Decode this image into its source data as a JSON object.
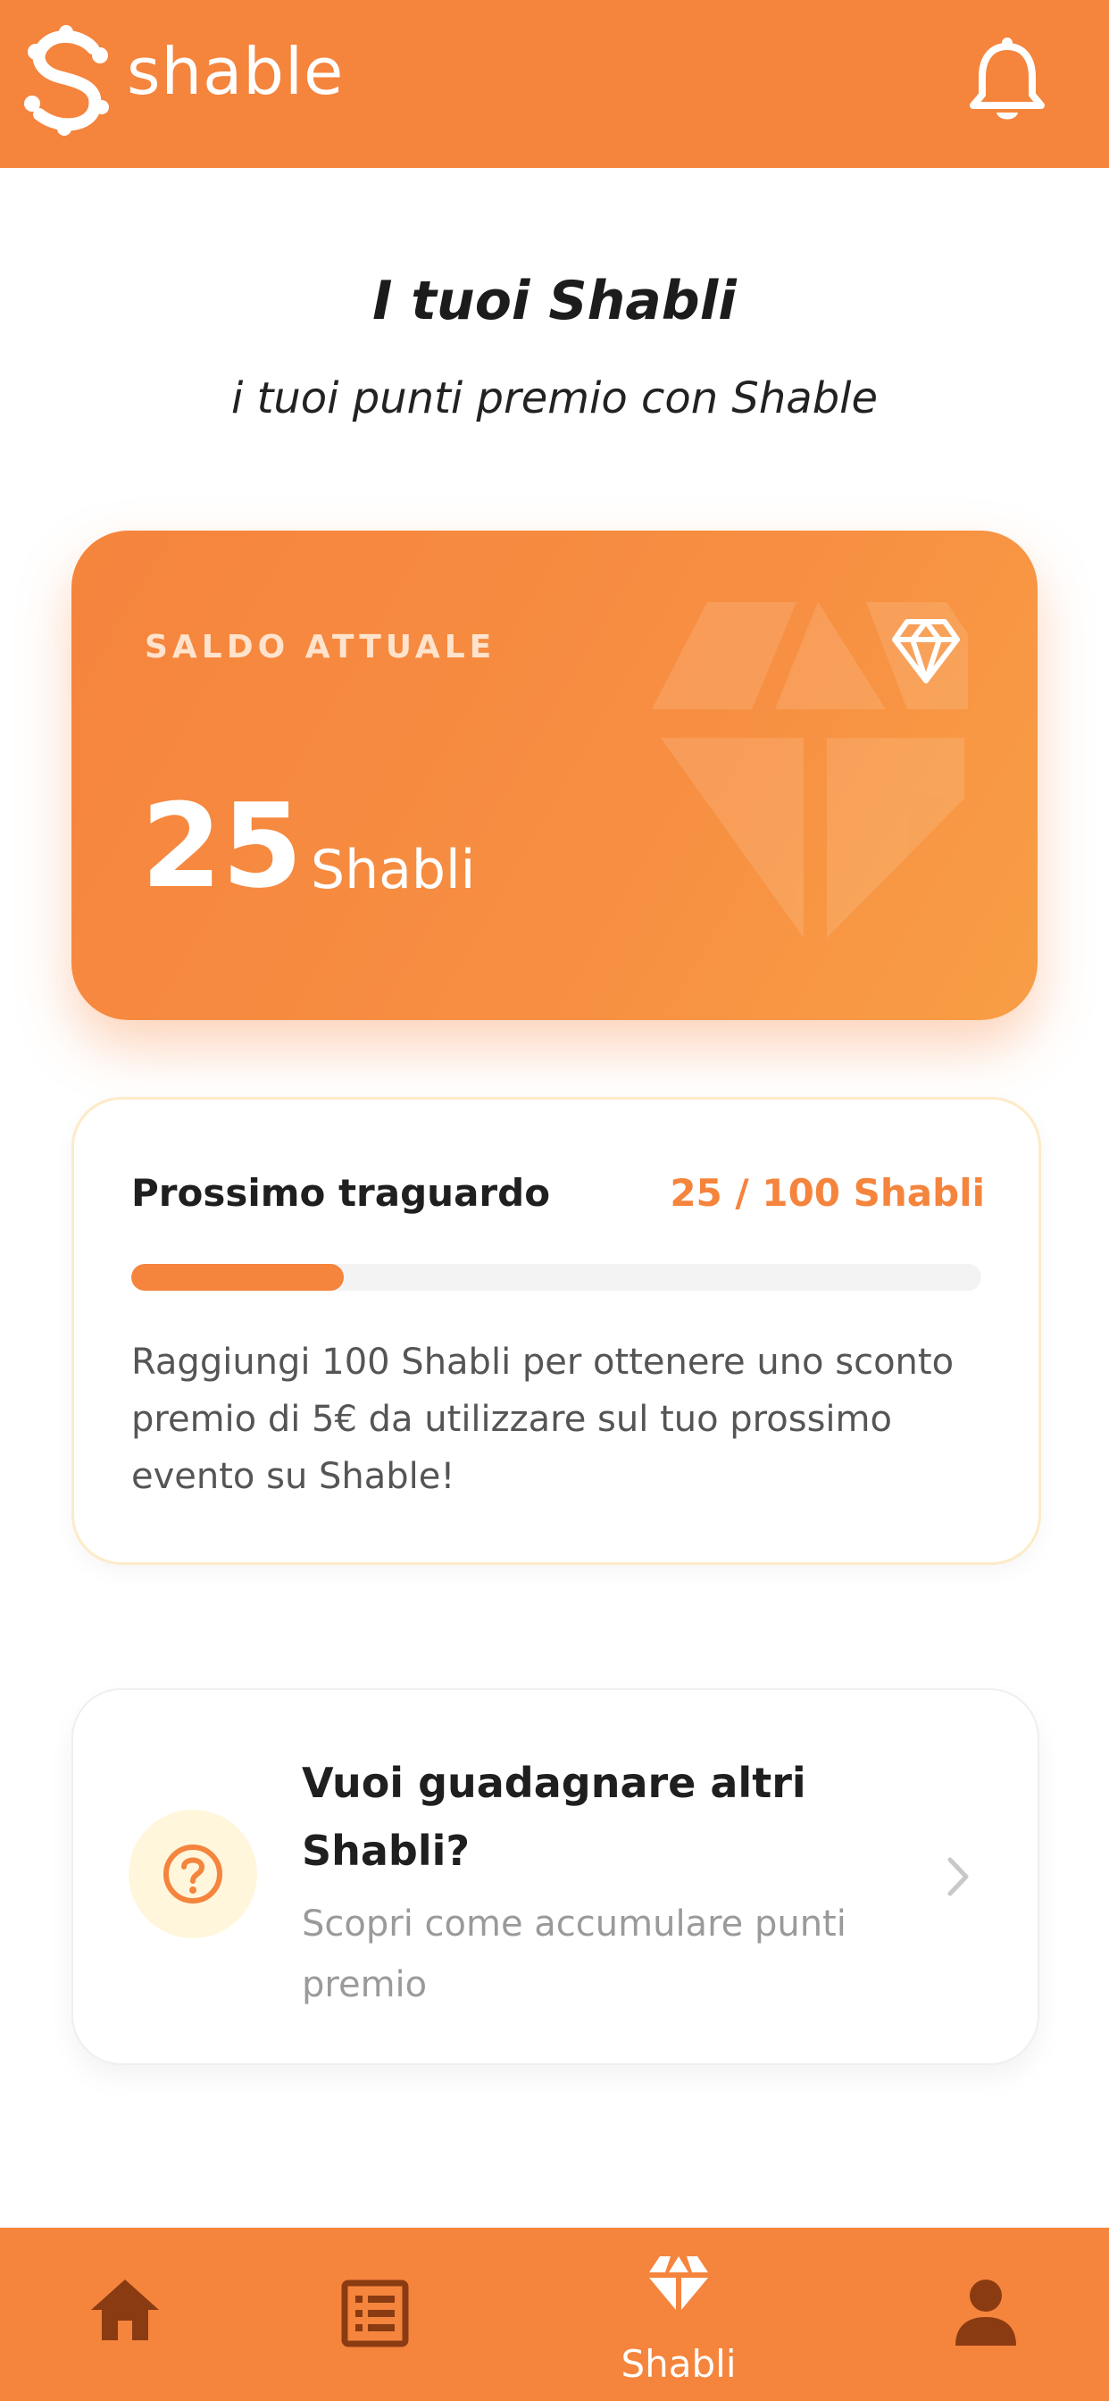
{
  "header": {
    "app_name": "shable",
    "logo_icon": "shable-logo-icon",
    "notification_icon": "bell-icon"
  },
  "page": {
    "title": "I tuoi Shabli",
    "subtitle": "i tuoi punti premio con Shable"
  },
  "balance": {
    "label": "SALDO ATTUALE",
    "value": "25",
    "unit": "Shabli",
    "icon": "diamond-icon"
  },
  "progress": {
    "title": "Prossimo traguardo",
    "count": "25 / 100 Shabli",
    "current": 25,
    "target": 100,
    "fraction": 0.25,
    "description": "Raggiungi 100 Shabli per ottenere uno sconto premio di 5€ da utilizzare sul tuo prossimo evento su Shable!"
  },
  "earn": {
    "title": "Vuoi guadagnare altri Shabli?",
    "subtitle": "Scopri come accumulare punti premio",
    "icon": "question-icon",
    "chevron": "chevron-right-icon"
  },
  "bottom_nav": {
    "items": [
      {
        "icon": "home-icon"
      },
      {
        "icon": "list-icon"
      },
      {
        "icon": "diamond-icon",
        "label": "Shabli",
        "active": true
      },
      {
        "icon": "profile-icon"
      }
    ]
  },
  "colors": {
    "brand": "#F5843D",
    "accent_light": "#FFF6DC",
    "track": "#F3F3F3"
  }
}
